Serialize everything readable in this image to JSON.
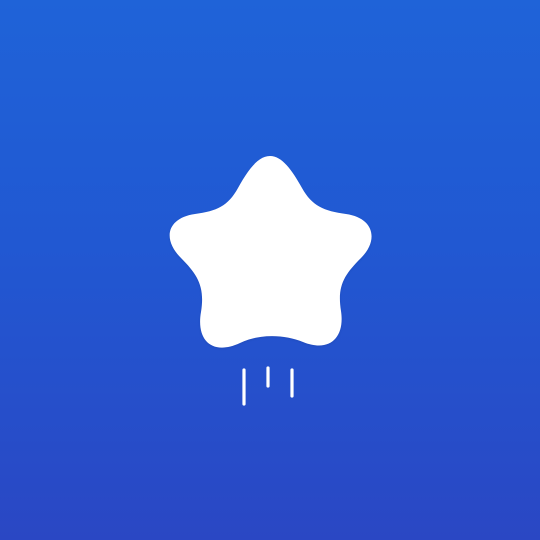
{
  "app": {
    "screen": "splash",
    "logo_icon": "rounded-star-with-motion-lines-icon"
  },
  "colors": {
    "background_top": "#1f63d8",
    "background_bottom": "#2a47c4",
    "logo": "#ffffff"
  }
}
